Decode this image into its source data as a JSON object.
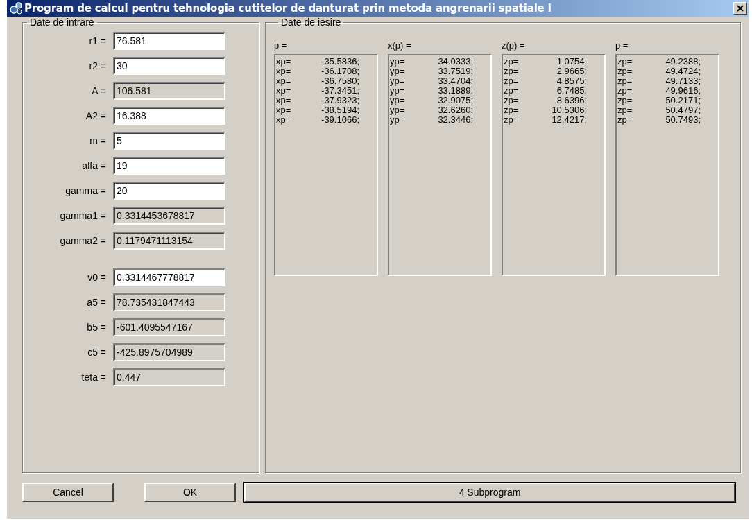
{
  "window": {
    "title": "Program  de calcul pentru tehnologia cutitelor de danturat prin metoda angrenarii spatiale I"
  },
  "input_group": {
    "title": "Date de intrare",
    "field_groups": [
      [
        {
          "label": "r1 =",
          "value": "76.581",
          "readonly": false
        },
        {
          "label": "r2 =",
          "value": "30",
          "readonly": false
        },
        {
          "label": "A =",
          "value": "106.581",
          "readonly": true
        },
        {
          "label": "A2 =",
          "value": "16.388",
          "readonly": false
        },
        {
          "label": "m =",
          "value": "5",
          "readonly": false
        },
        {
          "label": "alfa =",
          "value": "19",
          "readonly": false
        },
        {
          "label": "gamma =",
          "value": "20",
          "readonly": false
        },
        {
          "label": "gamma1 =",
          "value": "0.3314453678817",
          "readonly": true
        },
        {
          "label": "gamma2 =",
          "value": "0.1179471113154",
          "readonly": true
        }
      ],
      [
        {
          "label": "v0 =",
          "value": "0.3314467778817",
          "readonly": false
        },
        {
          "label": "a5 =",
          "value": "78.735431847443",
          "readonly": true
        },
        {
          "label": "b5 =",
          "value": "-601.4095547167",
          "readonly": true
        },
        {
          "label": "c5 =",
          "value": "-425.8975704989",
          "readonly": true
        },
        {
          "label": "teta =",
          "value": "0.447",
          "readonly": true
        }
      ]
    ]
  },
  "output_group": {
    "title": "Date de iesire",
    "lists": [
      {
        "caption": "p =",
        "rows": [
          [
            "xp=",
            "-35.5836;"
          ],
          [
            "xp=",
            "-36.1708;"
          ],
          [
            "xp=",
            "-36.7580;"
          ],
          [
            "xp=",
            "-37.3451;"
          ],
          [
            "xp=",
            "-37.9323;"
          ],
          [
            "xp=",
            "-38.5194;"
          ],
          [
            "xp=",
            "-39.1066;"
          ]
        ]
      },
      {
        "caption": "x(p) =",
        "rows": [
          [
            "yp=",
            "34.0333;"
          ],
          [
            "yp=",
            "33.7519;"
          ],
          [
            "yp=",
            "33.4704;"
          ],
          [
            "yp=",
            "33.1889;"
          ],
          [
            "yp=",
            "32.9075;"
          ],
          [
            "yp=",
            "32.6260;"
          ],
          [
            "yp=",
            "32.3446;"
          ]
        ]
      },
      {
        "caption": "z(p) =",
        "rows": [
          [
            "zp=",
            "1.0754;"
          ],
          [
            "zp=",
            "2.9665;"
          ],
          [
            "zp=",
            "4.8575;"
          ],
          [
            "zp=",
            "6.7485;"
          ],
          [
            "zp=",
            "8.6396;"
          ],
          [
            "zp=",
            "10.5306;"
          ],
          [
            "zp=",
            "12.4217;"
          ]
        ]
      },
      {
        "caption": "p =",
        "rows": [
          [
            "zp=",
            "49.2388;"
          ],
          [
            "zp=",
            "49.4724;"
          ],
          [
            "zp=",
            "49.7133;"
          ],
          [
            "zp=",
            "49.9616;"
          ],
          [
            "zp=",
            "50.2171;"
          ],
          [
            "zp=",
            "50.4797;"
          ],
          [
            "zp=",
            "50.7493;"
          ]
        ]
      }
    ]
  },
  "buttons": {
    "cancel": "Cancel",
    "ok": "OK",
    "subprogram": "4 Subprogram"
  }
}
